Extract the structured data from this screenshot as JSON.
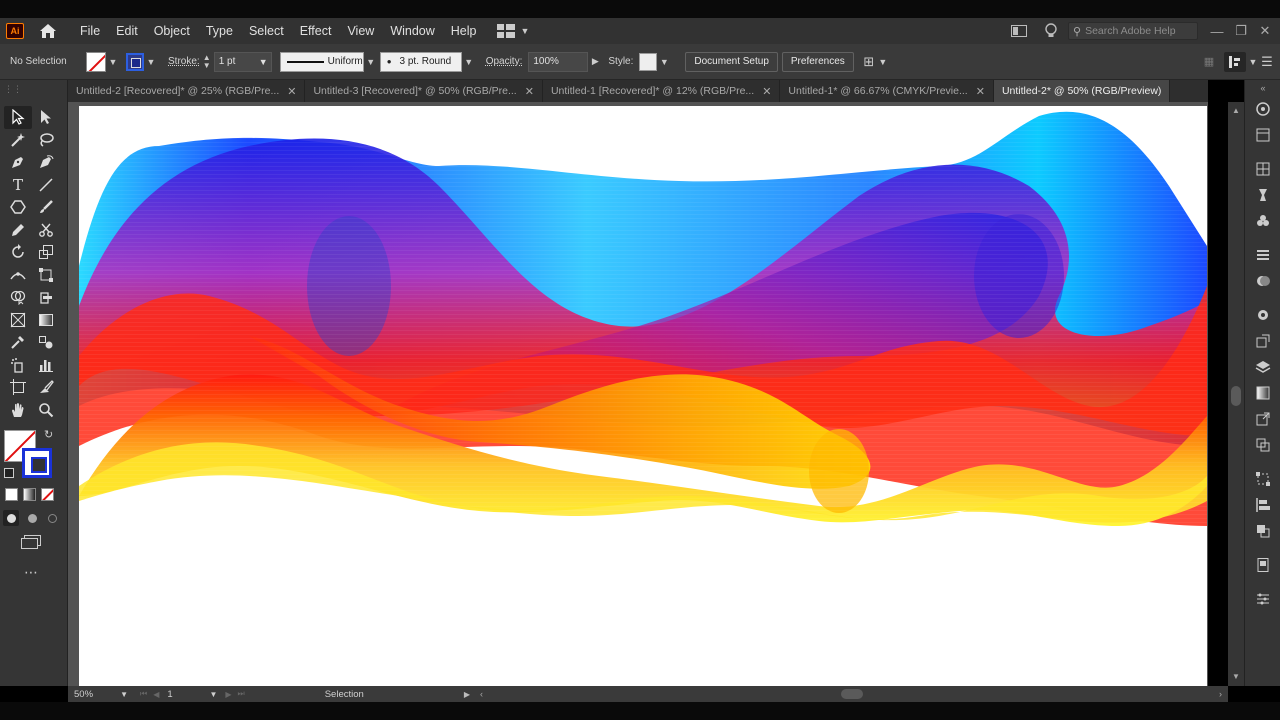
{
  "app": {
    "logo_text": "Ai",
    "accent": "#ff7c00"
  },
  "menu": {
    "items": [
      "File",
      "Edit",
      "Object",
      "Type",
      "Select",
      "Effect",
      "View",
      "Window",
      "Help"
    ],
    "search_placeholder": "Search Adobe Help"
  },
  "controlbar": {
    "selection_label": "No Selection",
    "stroke_label": "Stroke:",
    "stroke_value": "1 pt",
    "profile_label": "Uniform",
    "brush_label": "3 pt. Round",
    "opacity_label": "Opacity:",
    "opacity_value": "100%",
    "style_label": "Style:",
    "document_setup": "Document Setup",
    "preferences": "Preferences"
  },
  "tabs": [
    {
      "label": "Untitled-2 [Recovered]* @ 25% (RGB/Pre...",
      "active": false
    },
    {
      "label": "Untitled-3 [Recovered]* @ 50% (RGB/Pre...",
      "active": false
    },
    {
      "label": "Untitled-1 [Recovered]* @ 12% (RGB/Pre...",
      "active": false
    },
    {
      "label": "Untitled-1* @ 66.67% (CMYK/Previe...",
      "active": false
    },
    {
      "label": "Untitled-2* @ 50% (RGB/Preview)",
      "active": true
    }
  ],
  "statusbar": {
    "zoom": "50%",
    "artboard_number": "1",
    "tool_name": "Selection"
  },
  "colors": {
    "fill": "none",
    "stroke": "#1a32d8",
    "wave_cyan": "#00c8ff",
    "wave_blue": "#1020e0",
    "wave_red": "#ff1010",
    "wave_orange": "#ff8a00",
    "wave_yellow": "#fff23a"
  }
}
